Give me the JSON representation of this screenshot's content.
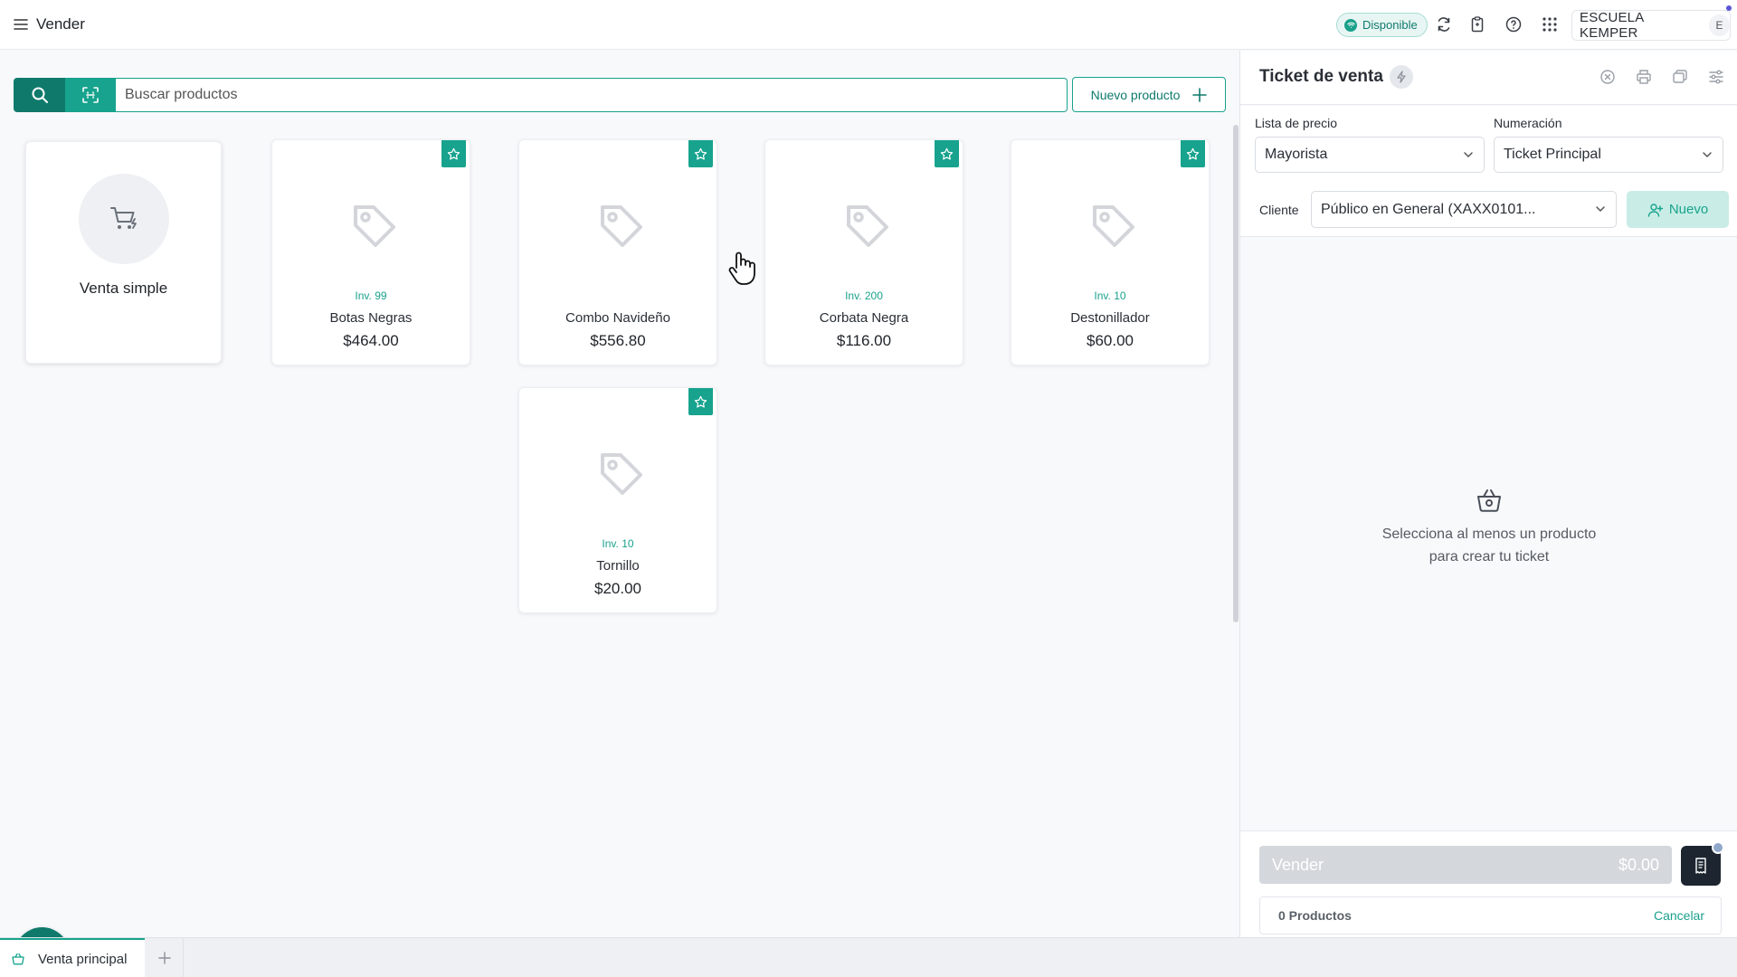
{
  "topbar": {
    "title": "Vender",
    "status": "Disponible",
    "account_name": "ESCUELA KEMPER",
    "account_initial": "E"
  },
  "search": {
    "placeholder": "Buscar productos",
    "new_product_label": "Nuevo producto"
  },
  "simple_sale": {
    "label": "Venta simple"
  },
  "products": [
    {
      "inventory": "Inv. 99",
      "name": "Botas Negras",
      "price": "$464.00"
    },
    {
      "inventory": "",
      "name": "Combo Navideño",
      "price": "$556.80"
    },
    {
      "inventory": "Inv. 200",
      "name": "Corbata Negra",
      "price": "$116.00"
    },
    {
      "inventory": "Inv. 10",
      "name": "Destonillador",
      "price": "$60.00"
    },
    {
      "inventory": "Inv. 10",
      "name": "Tornillo",
      "price": "$20.00"
    }
  ],
  "ticket": {
    "title": "Ticket de venta",
    "price_list_label": "Lista de precio",
    "price_list_value": "Mayorista",
    "numbering_label": "Numeración",
    "numbering_value": "Ticket Principal",
    "client_label": "Cliente",
    "client_value": "Público en General (XAXX0101...",
    "new_client_label": "Nuevo",
    "empty_line1": "Selecciona al menos un producto",
    "empty_line2": "para crear tu ticket",
    "sell_label": "Vender",
    "sell_total": "$0.00",
    "product_count": "0 Productos",
    "cancel_label": "Cancelar"
  },
  "tabs": [
    {
      "label": "Venta principal"
    }
  ],
  "colors": {
    "primary": "#0f7a6c",
    "accent": "#17a38d",
    "dark_button": "#1d2530"
  }
}
